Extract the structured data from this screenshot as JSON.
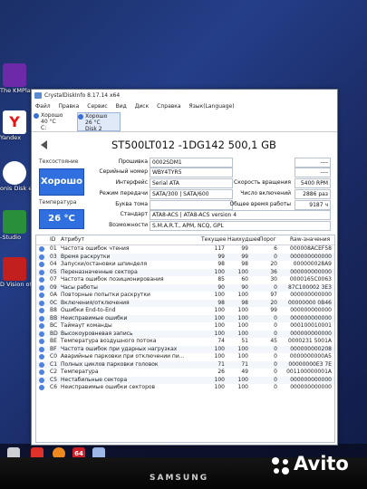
{
  "desktop": {
    "icons": [
      {
        "label": "The KMPlayer",
        "color": "#6c2aa8"
      },
      {
        "label": "Yandex",
        "color": "#ffffff"
      },
      {
        "label": "onis Disk ector 12.5",
        "color": "#1f2d59"
      },
      {
        "label": "-Studio",
        "color": "#e02020"
      },
      {
        "label": "D Vision oto Viewer",
        "color": "#c21f1f"
      }
    ],
    "taskbar": {
      "badge": "64"
    },
    "brand": "SAMSUNG",
    "watermark": "Avito"
  },
  "window": {
    "title": "CrystalDiskInfo 8.17.14 x64",
    "menu": [
      "Файл",
      "Правка",
      "Сервис",
      "Вид",
      "Диск",
      "Справка",
      "Язык(Language)"
    ],
    "disk_tabs": [
      {
        "status": "Хорошо",
        "temp": "40 °C",
        "name": "C:"
      },
      {
        "status": "Хорошо",
        "temp": "26 °C",
        "name": "Disk 2"
      }
    ],
    "model": "ST500LT012 -1DG142 500,1 GB",
    "health_label": "Техсостояние",
    "health_value": "Хорошо",
    "temp_label": "Температура",
    "temp_value": "26 °C",
    "fields": {
      "firmware": {
        "label": "Прошивка",
        "value": "0002SDM1"
      },
      "serial": {
        "label": "Серийный номер",
        "value": "WBY4TYR5"
      },
      "interface": {
        "label": "Интерфейс",
        "value": "Serial ATA"
      },
      "transfer": {
        "label": "Режим передачи",
        "value": "SATA/300 | SATA/600"
      },
      "letter": {
        "label": "Буква тома",
        "value": ""
      },
      "standard": {
        "label": "Стандарт",
        "value": "ATA8-ACS | ATA8-ACS version 4"
      },
      "features": {
        "label": "Возможности",
        "value": "S.M.A.R.T., APM, NCQ, GPL"
      },
      "r1a": {
        "label": "",
        "value": "----"
      },
      "r1b": {
        "label": "",
        "value": "----"
      },
      "rpm": {
        "label": "Скорость вращения",
        "value": "5400 RPM"
      },
      "poweron": {
        "label": "Число включений",
        "value": "2886 раз"
      },
      "hours": {
        "label": "Общее время работы",
        "value": "9187 ч"
      }
    },
    "table": {
      "headers": {
        "id": "ID",
        "name": "Атрибут",
        "current": "Текущее",
        "worst": "Наихудшее",
        "threshold": "Порог",
        "raw": "Raw-значения"
      },
      "rows": [
        {
          "id": "01",
          "name": "Частота ошибок чтения",
          "current": "117",
          "worst": "99",
          "threshold": "6",
          "raw": "000008ACEF58"
        },
        {
          "id": "03",
          "name": "Время раскрутки",
          "current": "99",
          "worst": "99",
          "threshold": "0",
          "raw": "000000000000"
        },
        {
          "id": "04",
          "name": "Запуски/остановки шпинделя",
          "current": "98",
          "worst": "98",
          "threshold": "20",
          "raw": "000000028A9"
        },
        {
          "id": "05",
          "name": "Переназначенные сектора",
          "current": "100",
          "worst": "100",
          "threshold": "36",
          "raw": "000000000000"
        },
        {
          "id": "07",
          "name": "Частота ошибок позиционирования",
          "current": "85",
          "worst": "60",
          "threshold": "30",
          "raw": "0000165C0063"
        },
        {
          "id": "09",
          "name": "Часы работы",
          "current": "90",
          "worst": "90",
          "threshold": "0",
          "raw": "87C100002 3E3"
        },
        {
          "id": "0A",
          "name": "Повторные попытки раскрутки",
          "current": "100",
          "worst": "100",
          "threshold": "97",
          "raw": "000000000000"
        },
        {
          "id": "0C",
          "name": "Включения/отключения",
          "current": "98",
          "worst": "98",
          "threshold": "20",
          "raw": "00000000 0B46"
        },
        {
          "id": "B8",
          "name": "Ошибки End-to-End",
          "current": "100",
          "worst": "100",
          "threshold": "99",
          "raw": "000000000000"
        },
        {
          "id": "BB",
          "name": "Неисправимые ошибки",
          "current": "100",
          "worst": "100",
          "threshold": "0",
          "raw": "000000000000"
        },
        {
          "id": "BC",
          "name": "Таймаут команды",
          "current": "100",
          "worst": "100",
          "threshold": "0",
          "raw": "000100010001"
        },
        {
          "id": "BD",
          "name": "Высокоуровневая запись",
          "current": "100",
          "worst": "100",
          "threshold": "0",
          "raw": "000000000000"
        },
        {
          "id": "BE",
          "name": "Температура воздушного потока",
          "current": "74",
          "worst": "51",
          "threshold": "45",
          "raw": "0000231 5001A"
        },
        {
          "id": "BF",
          "name": "Частота ошибок при ударных нагрузках",
          "current": "100",
          "worst": "100",
          "threshold": "0",
          "raw": "000000000208"
        },
        {
          "id": "C0",
          "name": "Аварийные парковки при отключении пи...",
          "current": "100",
          "worst": "100",
          "threshold": "0",
          "raw": "0000000000A5"
        },
        {
          "id": "C1",
          "name": "Полных циклов парковки головок",
          "current": "71",
          "worst": "71",
          "threshold": "0",
          "raw": "00000000E3 7E"
        },
        {
          "id": "C2",
          "name": "Температура",
          "current": "26",
          "worst": "49",
          "threshold": "0",
          "raw": "001100000001A"
        },
        {
          "id": "C5",
          "name": "Нестабильные сектора",
          "current": "100",
          "worst": "100",
          "threshold": "0",
          "raw": "000000000000"
        },
        {
          "id": "C6",
          "name": "Неисправимые ошибки секторов",
          "current": "100",
          "worst": "100",
          "threshold": "0",
          "raw": "000000000000"
        }
      ]
    }
  }
}
